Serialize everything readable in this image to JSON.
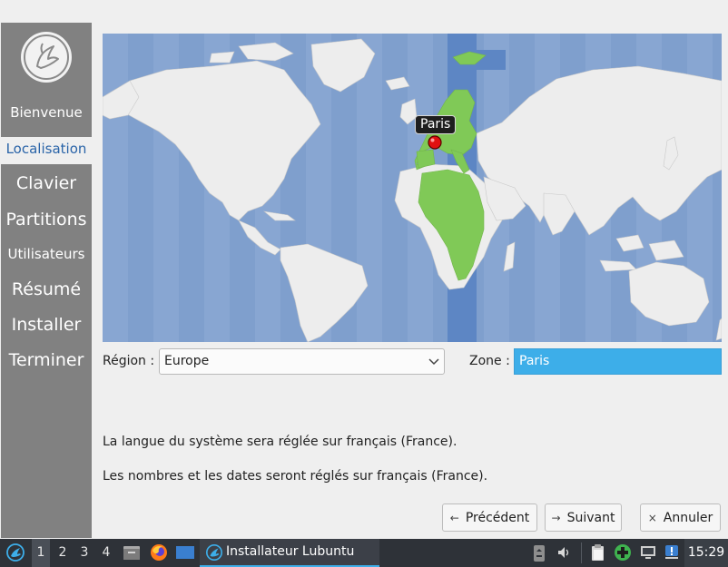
{
  "sidebar": {
    "items": [
      {
        "label": "Bienvenue",
        "active": false
      },
      {
        "label": "Localisation",
        "active": true
      },
      {
        "label": "Clavier",
        "active": false
      },
      {
        "label": "Partitions",
        "active": false
      },
      {
        "label": "Utilisateurs",
        "active": false
      },
      {
        "label": "Résumé",
        "active": false
      },
      {
        "label": "Installer",
        "active": false
      },
      {
        "label": "Terminer",
        "active": false
      }
    ]
  },
  "map": {
    "pin_label": "Paris",
    "colors": {
      "ocean": "#7f9fcd",
      "land": "#ededed",
      "selected_zone": "#80c957",
      "pin": "#e01010"
    }
  },
  "form": {
    "region_label": "Région :",
    "region_value": "Europe",
    "zone_label": "Zone :",
    "zone_value": "Paris"
  },
  "messages": {
    "language": "La langue du système sera réglée sur français (France).",
    "numbers": "Les nombres et les dates seront réglés sur français (France)."
  },
  "buttons": {
    "previous": "Précédent",
    "next": "Suivant",
    "cancel": "Annuler"
  },
  "taskbar": {
    "desktops": [
      "1",
      "2",
      "3",
      "4"
    ],
    "active_desktop": "1",
    "task_title": "Installateur Lubuntu",
    "clock": "15:29"
  }
}
